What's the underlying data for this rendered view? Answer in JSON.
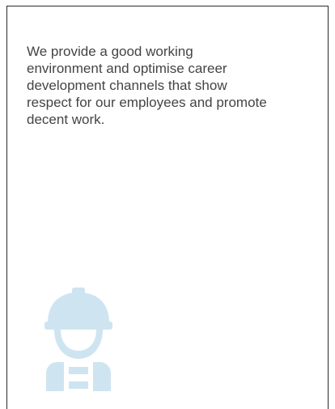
{
  "card": {
    "description": "We provide a good working environment and optimise career development channels that show respect for our employees and promote decent work."
  },
  "icon": {
    "name": "construction-worker-icon",
    "color": "#cfe4f1"
  }
}
